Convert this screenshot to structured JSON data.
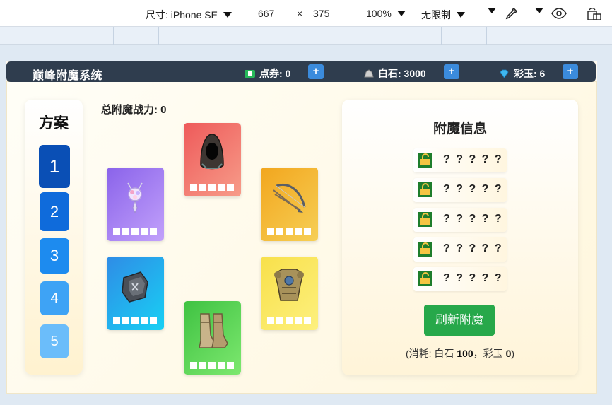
{
  "devtools": {
    "dimensions_label": "尺寸: iPhone SE",
    "width_value": "667",
    "times": "×",
    "height_value": "375",
    "zoom": "100%",
    "throttle": "无限制"
  },
  "topbar": {
    "title": "巅峰附魔系统",
    "coupons_label": "点券: 0",
    "whitestone_label": "白石: 3000",
    "jade_label": "彩玉: 6",
    "plus": "+"
  },
  "plans": {
    "title": "方案",
    "items": [
      {
        "label": "1",
        "color": "#0a4fb5",
        "selected": true
      },
      {
        "label": "2",
        "color": "#0f6bdb",
        "selected": false
      },
      {
        "label": "3",
        "color": "#1d8bef",
        "selected": false
      },
      {
        "label": "4",
        "color": "#3ea3f5",
        "selected": false
      },
      {
        "label": "5",
        "color": "#6bbdfa",
        "selected": false
      }
    ]
  },
  "main": {
    "total_power": "总附魔战力: 0",
    "equipment": [
      {
        "name": "necklace",
        "gradient": [
          "#8a63ea",
          "#c2a1fb"
        ]
      },
      {
        "name": "helmet",
        "gradient": [
          "#ee5a5a",
          "#f79c89"
        ]
      },
      {
        "name": "bow",
        "gradient": [
          "#f2a61e",
          "#f6cf55"
        ]
      },
      {
        "name": "bracer",
        "gradient": [
          "#2f8ce6",
          "#18d0f4"
        ]
      },
      {
        "name": "boots",
        "gradient": [
          "#3fc242",
          "#7de86f"
        ]
      },
      {
        "name": "armor",
        "gradient": [
          "#f8e04a",
          "#fdf07e"
        ]
      }
    ]
  },
  "info": {
    "title": "附魔信息",
    "rows": [
      "? ? ? ? ?",
      "? ? ? ? ?",
      "? ? ? ? ?",
      "? ? ? ? ?",
      "? ? ? ? ?"
    ],
    "refresh_button": "刷新附魔",
    "cost_prefix": "(消耗: 白石 ",
    "cost_stone": "100",
    "cost_mid": "，彩玉 ",
    "cost_jade": "0",
    "cost_suffix": ")"
  }
}
